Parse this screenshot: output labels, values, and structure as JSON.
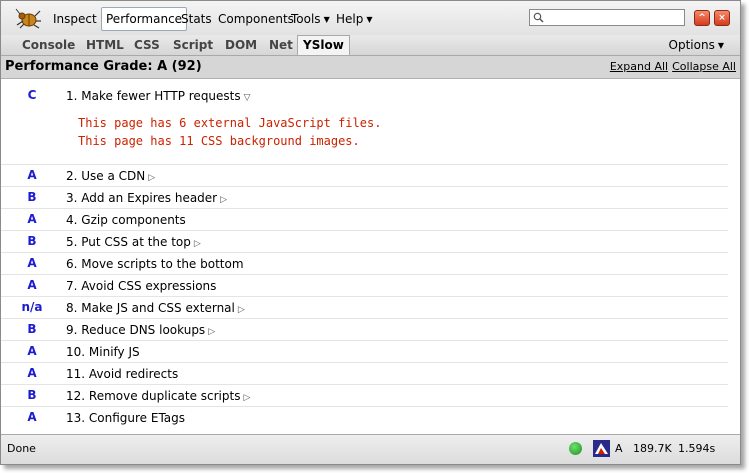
{
  "toolbar": {
    "inspect": "Inspect",
    "performance": "Performance",
    "stats": "Stats",
    "components": "Components",
    "tools": "Tools",
    "help": "Help",
    "search_value": ""
  },
  "tabs": [
    "Console",
    "HTML",
    "CSS",
    "Script",
    "DOM",
    "Net",
    "YSlow"
  ],
  "options": "Options",
  "grade_header": {
    "title": "Performance Grade: A (92)",
    "expand_all": "Expand All",
    "collapse_all": "Collapse All"
  },
  "rules": [
    {
      "grade": "C",
      "label": "1. Make fewer HTTP requests",
      "expanded": true,
      "details": [
        "This page has 6 external JavaScript files.",
        "This page has 11 CSS background images."
      ]
    },
    {
      "grade": "A",
      "label": "2. Use a CDN"
    },
    {
      "grade": "B",
      "label": "3. Add an Expires header"
    },
    {
      "grade": "A",
      "label": "4. Gzip components"
    },
    {
      "grade": "B",
      "label": "5. Put CSS at the top"
    },
    {
      "grade": "A",
      "label": "6. Move scripts to the bottom"
    },
    {
      "grade": "A",
      "label": "7. Avoid CSS expressions"
    },
    {
      "grade": "n/a",
      "label": "8. Make JS and CSS external"
    },
    {
      "grade": "B",
      "label": "9. Reduce DNS lookups"
    },
    {
      "grade": "A",
      "label": "10. Minify JS"
    },
    {
      "grade": "A",
      "label": "11. Avoid redirects"
    },
    {
      "grade": "B",
      "label": "12. Remove duplicate scripts"
    },
    {
      "grade": "A",
      "label": "13. Configure ETags"
    }
  ],
  "status": {
    "text": "Done",
    "grade": "A",
    "size": "189.7K",
    "time": "1.594s"
  },
  "colors": {
    "grade": "#1c1cd0",
    "detail": "#cc2200"
  },
  "icons": [
    "firebug-icon",
    "search-icon",
    "minimize-icon",
    "close-icon",
    "check-icon",
    "yslow-icon",
    "expand-triangle-icon"
  ]
}
